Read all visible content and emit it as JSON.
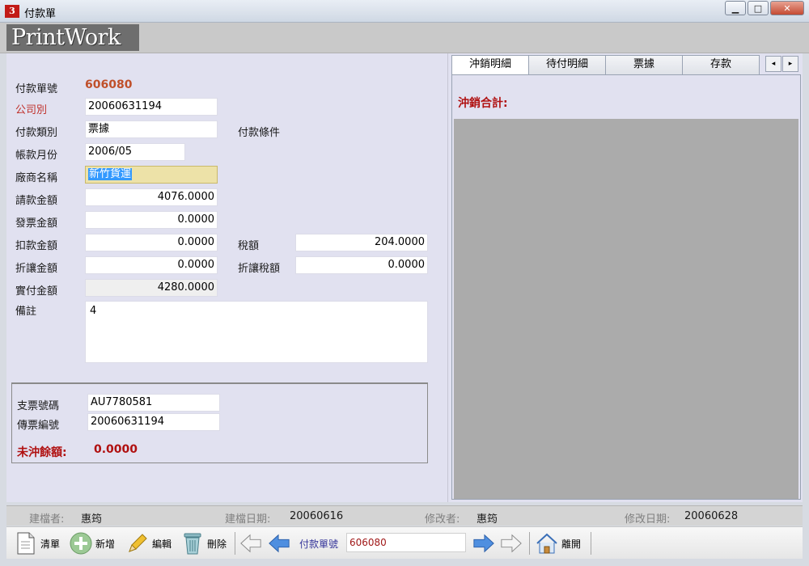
{
  "window": {
    "title": "付款單",
    "app_icon_text": "3",
    "min_label": "▁",
    "max_label": "□",
    "close_label": "✕"
  },
  "banner": {
    "logo": "PrintWork"
  },
  "form": {
    "doc_no_label": "付款單號",
    "doc_no": "606080",
    "company_label": "公司別",
    "company": "20060631194",
    "pay_type_label": "付款類別",
    "pay_type": "票據",
    "pay_terms_label": "付款條件",
    "account_month_label": "帳款月份",
    "account_month": "2006/05",
    "vendor_label": "廠商名稱",
    "vendor": "新竹貨運",
    "request_amount_label": "請款金額",
    "request_amount": "4076.0000",
    "invoice_amount_label": "發票金額",
    "invoice_amount": "0.0000",
    "deduction_label": "扣款金額",
    "deduction": "0.0000",
    "tax_label": "稅額",
    "tax": "204.0000",
    "discount_label": "折讓金額",
    "discount": "0.0000",
    "discount_tax_label": "折讓稅額",
    "discount_tax": "0.0000",
    "actual_pay_label": "實付金額",
    "actual_pay": "4280.0000",
    "remark_label": "備註",
    "remark": "4"
  },
  "subpanel": {
    "cheque_no_label": "支票號碼",
    "cheque_no": "AU7780581",
    "voucher_no_label": "傳票編號",
    "voucher_no": "20060631194",
    "unpaid_label": "未沖餘額:",
    "unpaid_value": "0.0000"
  },
  "tabs": {
    "items": [
      {
        "label": "沖銷明細"
      },
      {
        "label": "待付明細"
      },
      {
        "label": "票據"
      },
      {
        "label": "存款"
      }
    ],
    "prev": "◂",
    "next": "▸",
    "sum_label": "沖銷合計:"
  },
  "status": {
    "creator_label": "建檔者:",
    "creator": "惠筠",
    "created_label": "建檔日期:",
    "created": "20060616",
    "modifier_label": "修改者:",
    "modifier": "惠筠",
    "modified_label": "修改日期:",
    "modified": "20060628"
  },
  "toolbar": {
    "clear_label": "清單",
    "add_label": "新增",
    "edit_label": "編輯",
    "delete_label": "刪除",
    "nav_field_label": "付款單號",
    "nav_field_value": "606080",
    "exit_label": "離開"
  },
  "icons": {
    "clear": "document-icon",
    "add": "plus-circle-icon",
    "edit": "pencil-icon",
    "delete": "trash-icon",
    "first": "arrow-left-outline-icon",
    "prev": "arrow-left-icon",
    "next": "arrow-right-icon",
    "last": "arrow-right-outline-icon",
    "exit": "home-icon"
  },
  "colors": {
    "accent_red": "#c0302a",
    "alert_red": "#b01010",
    "panel_bg": "#e1e1f0",
    "highlight_field": "#ede2a8",
    "nav_blue": "#2d6cc9"
  }
}
